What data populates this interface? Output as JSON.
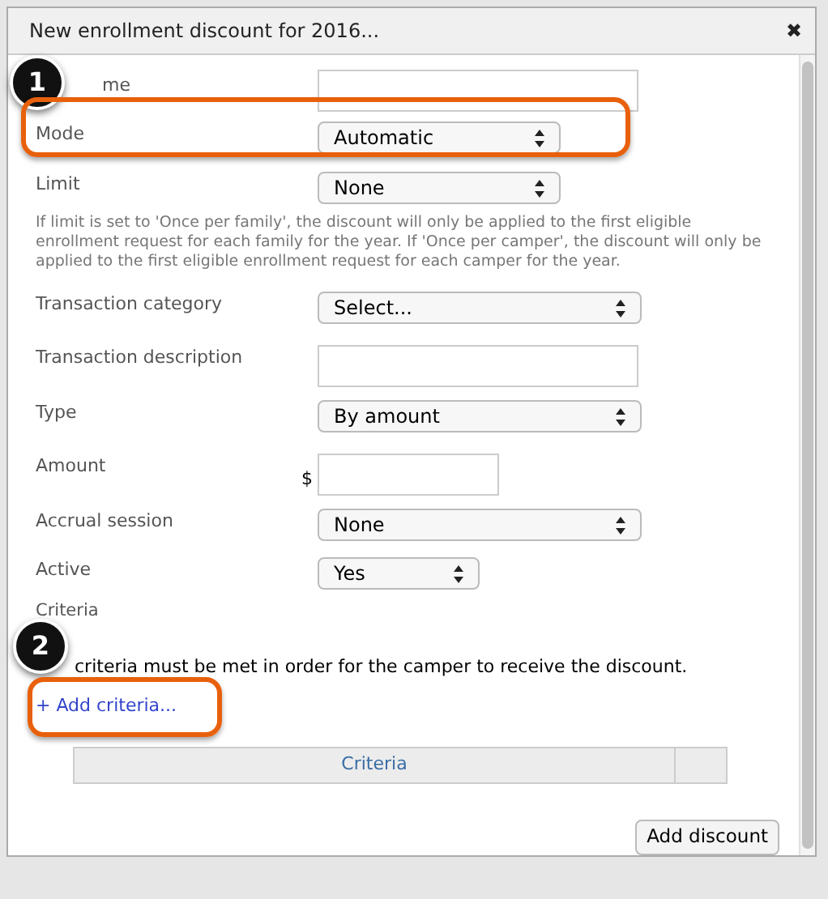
{
  "dialog": {
    "title": "New enrollment discount for 2016...",
    "close": "✖"
  },
  "fields": [
    {
      "label": "me",
      "kind": "text"
    },
    {
      "label": "Mode",
      "kind": "select",
      "value": "Automatic"
    },
    {
      "label": "Limit",
      "kind": "select",
      "value": "None"
    },
    {
      "kind": "help",
      "text": "If limit is set to 'Once per family', the discount will only be applied to the first eligible enrollment request for each family for the year. If 'Once per camper', the discount will only be applied to the first eligible enrollment request for each camper for the year."
    },
    {
      "label": "Transaction category",
      "kind": "select",
      "value": "Select..."
    },
    {
      "label": "Transaction description",
      "kind": "text"
    },
    {
      "label": "Type",
      "kind": "select",
      "value": "By amount"
    },
    {
      "label": "Amount",
      "kind": "money",
      "prefix": "$"
    },
    {
      "label": "Accrual session",
      "kind": "select",
      "value": "None"
    },
    {
      "label": "Active",
      "kind": "select",
      "value": "Yes"
    }
  ],
  "criteria": {
    "heading": "Criteria",
    "note": "criteria must be met in order for the camper to receive the discount.",
    "add_link": "+ Add criteria...",
    "table_columns": [
      "Criteria"
    ]
  },
  "submit": "Add discount",
  "callouts": [
    {
      "number": "1"
    },
    {
      "number": "2"
    }
  ]
}
